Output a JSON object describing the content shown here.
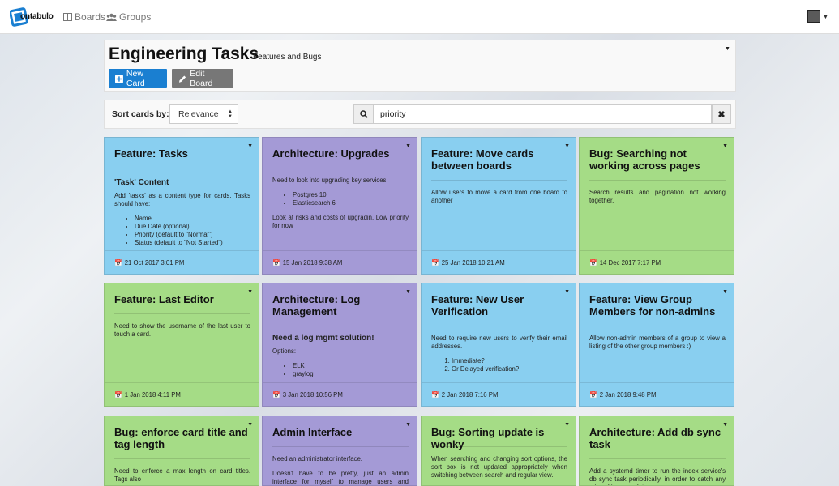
{
  "nav": {
    "logo_text": "ontabulo",
    "boards_label": "Boards",
    "groups_label": "Groups"
  },
  "board": {
    "title": "Engineering Tasks",
    "separator": "|",
    "subtitle": "Features and Bugs",
    "new_card_label": "New Card",
    "edit_board_label": "Edit Board"
  },
  "filter": {
    "sort_label": "Sort cards by:",
    "sort_value": "Relevance",
    "search_value": "priority"
  },
  "colors": {
    "blue": "#89cff0",
    "purple": "#a49ad6",
    "green": "#a5dc86",
    "primary": "#1a7fd1"
  },
  "cards": [
    {
      "title": "Feature: Tasks",
      "date": "21 Oct 2017 3:01 PM",
      "heading": "'Task' Content",
      "p1": "Add 'tasks' as a content type for cards. Tasks should have:",
      "li1": "Name",
      "li2": "Due Date (optional)",
      "li3": "Priority (default to \"Normal\")",
      "li4": "Status (default to \"Not Started\")"
    },
    {
      "title": "Architecture: Upgrades",
      "date": "15 Jan 2018 9:38 AM",
      "p1": "Need to look into upgrading key services:",
      "li1": "Postgres 10",
      "li2": "Elasticsearch 6",
      "p2": "Look at risks and costs of upgradin. Low priority for now"
    },
    {
      "title": "Feature: Move cards between boards",
      "date": "25 Jan 2018 10:21 AM",
      "p1": "Allow users to move a card from one board to another"
    },
    {
      "title": "Bug: Searching not working across pages",
      "date": "14 Dec 2017 7:17 PM",
      "p1": "Search results and pagination not working together."
    },
    {
      "title": "Feature: Last Editor",
      "date": "1 Jan 2018 4:11 PM",
      "p1": "Need to show the username of the last user to touch a card."
    },
    {
      "title": "Architecture: Log Management",
      "date": "3 Jan 2018 10:56 PM",
      "heading": "Need a log mgmt solution!",
      "p1": "Options:",
      "li1": "ELK",
      "li2": "graylog"
    },
    {
      "title": "Feature: New User Verification",
      "date": "2 Jan 2018 7:16 PM",
      "p1": "Need to require new users to verify their email addresses.",
      "li1": "Immediate?",
      "li2": "Or Delayed verification?"
    },
    {
      "title": "Feature: View Group Members for non-admins",
      "date": "2 Jan 2018 9:48 PM",
      "p1": "Allow non-admin members of a group to view a listing of the other group members :)"
    },
    {
      "title": "Bug: enforce card title and tag length",
      "p1": "Need to enforce a max length on card titles. Tags also"
    },
    {
      "title": "Admin Interface",
      "p1": "Need an administrator interface.",
      "p2": "Doesn't have to be pretty, just an admin interface for myself to manage users and content"
    },
    {
      "title": "Bug: Sorting update is wonky",
      "p1": "When searching and changing sort options, the sort box is not updated appropriately when switching between search and regular view."
    },
    {
      "title": "Architecture: Add db sync task",
      "p1": "Add a systemd timer to run the index service's db sync task periodically, in order to catch any missed index updates"
    }
  ]
}
